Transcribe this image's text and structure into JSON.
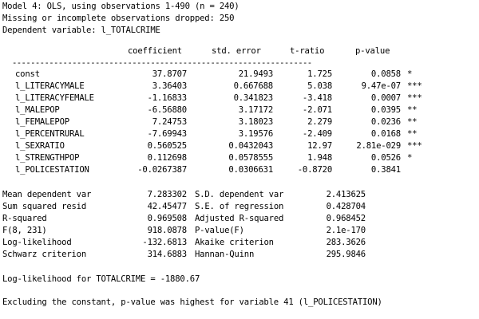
{
  "header": [
    "Model 4: OLS, using observations 1-490 (n = 240)",
    "Missing or incomplete observations dropped: 250",
    "Dependent variable: l_TOTALCRIME"
  ],
  "columns": {
    "coefficient": "coefficient",
    "std_error": "std. error",
    "t_ratio": "t-ratio",
    "p_value": "p-value"
  },
  "separator": "-----------------------------------------------------------------",
  "rows": [
    {
      "name": "const",
      "coef": "37.8707",
      "se": "21.9493",
      "t": "1.725",
      "p": "0.0858",
      "stars": "*"
    },
    {
      "name": "l_LITERACYMALE",
      "coef": "3.36403",
      "se": "0.667688",
      "t": "5.038",
      "p": "9.47e-07",
      "stars": "***"
    },
    {
      "name": "l_LITERACYFEMALE",
      "coef": "-1.16833",
      "se": "0.341823",
      "t": "-3.418",
      "p": "0.0007",
      "stars": "***"
    },
    {
      "name": "l_MALEPOP",
      "coef": "-6.56880",
      "se": "3.17172",
      "t": "-2.071",
      "p": "0.0395",
      "stars": "**"
    },
    {
      "name": "l_FEMALEPOP",
      "coef": "7.24753",
      "se": "3.18023",
      "t": "2.279",
      "p": "0.0236",
      "stars": "**"
    },
    {
      "name": "l_PERCENTRURAL",
      "coef": "-7.69943",
      "se": "3.19576",
      "t": "-2.409",
      "p": "0.0168",
      "stars": "**"
    },
    {
      "name": "l_SEXRATIO",
      "coef": "0.560525",
      "se": "0.0432043",
      "t": "12.97",
      "p": "2.81e-029",
      "stars": "***"
    },
    {
      "name": "l_STRENGTHPOP",
      "coef": "0.112698",
      "se": "0.0578555",
      "t": "1.948",
      "p": "0.0526",
      "stars": "*"
    },
    {
      "name": "l_POLICESTATION",
      "coef": "-0.0267387",
      "se": "0.0306631",
      "t": "-0.8720",
      "p": "0.3841",
      "stars": ""
    }
  ],
  "stats": [
    {
      "l1": "Mean dependent var",
      "v1": "7.283302",
      "l2": "S.D. dependent var",
      "v2": "2.413625"
    },
    {
      "l1": "Sum squared resid",
      "v1": "42.45477",
      "l2": "S.E. of regression",
      "v2": "0.428704"
    },
    {
      "l1": "R-squared",
      "v1": "0.969508",
      "l2": "Adjusted R-squared",
      "v2": "0.968452"
    },
    {
      "l1": "F(8, 231)",
      "v1": "918.0878",
      "l2": "P-value(F)",
      "v2": "2.1e-170"
    },
    {
      "l1": "Log-likelihood",
      "v1": "-132.6813",
      "l2": "Akaike criterion",
      "v2": "283.3626"
    },
    {
      "l1": "Schwarz criterion",
      "v1": "314.6883",
      "l2": "Hannan-Quinn",
      "v2": "295.9846"
    }
  ],
  "loglik_line": "Log-likelihood for TOTALCRIME = -1880.67",
  "footer_line": "Excluding the constant, p-value was highest for variable 41 (l_POLICESTATION)"
}
